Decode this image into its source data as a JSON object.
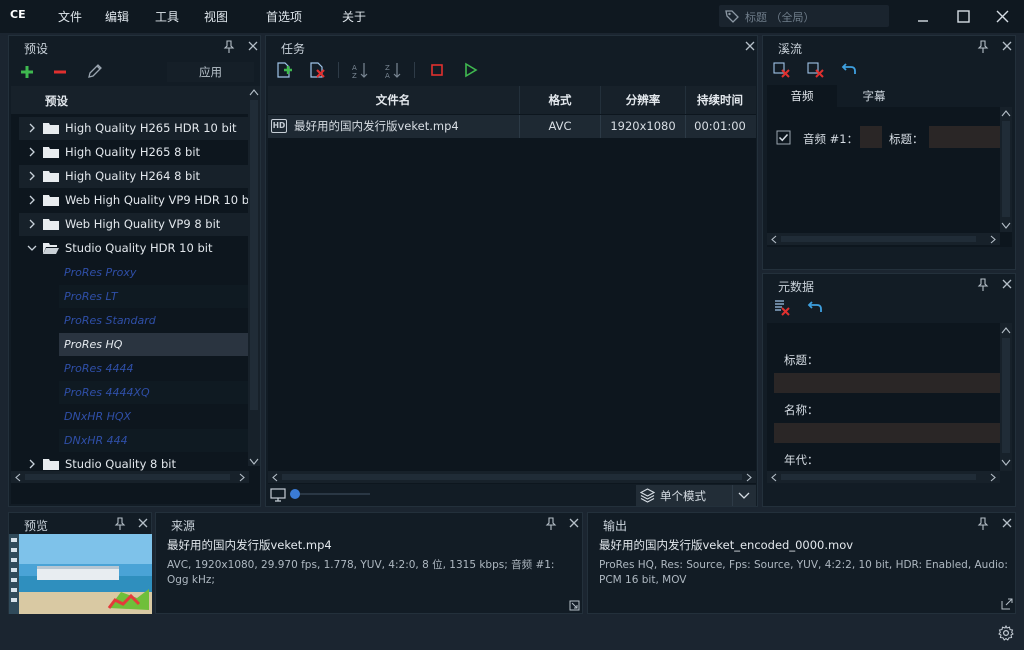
{
  "app": {
    "logo": "CE"
  },
  "menu": [
    "文件",
    "编辑",
    "工具",
    "视图",
    "首选项",
    "关于"
  ],
  "search": {
    "placeholder": "标题  （全局）"
  },
  "presets": {
    "title": "预设",
    "apply_label": "应用",
    "column_header": "预设",
    "groups": [
      {
        "label": "High Quality H265 HDR 10 bit",
        "expanded": false
      },
      {
        "label": "High Quality H265 8 bit",
        "expanded": false
      },
      {
        "label": "High Quality H264 8 bit",
        "expanded": false
      },
      {
        "label": "Web High Quality VP9 HDR 10 bit",
        "expanded": false
      },
      {
        "label": "Web High Quality VP9 8 bit",
        "expanded": false
      },
      {
        "label": "Studio Quality HDR 10 bit",
        "expanded": true
      },
      {
        "label": "Studio Quality 8 bit",
        "expanded": false
      }
    ],
    "sub_items": [
      "ProRes Proxy",
      "ProRes LT",
      "ProRes Standard",
      "ProRes HQ",
      "ProRes 4444",
      "ProRes 4444XQ",
      "DNxHR HQX",
      "DNxHR 444"
    ],
    "selected": "ProRes HQ"
  },
  "tasks": {
    "title": "任务",
    "columns": [
      "文件名",
      "格式",
      "分辨率",
      "持续时间"
    ],
    "rows": [
      {
        "filename": "最好用的国内发行版veket.mp4",
        "format": "AVC",
        "resolution": "1920x1080",
        "duration": "00:01:00",
        "badge": "HD"
      }
    ],
    "mode_label": "单个模式"
  },
  "streams": {
    "title": "溪流",
    "tabs": [
      "音频",
      "字幕"
    ],
    "audio_label": "音频 #1：",
    "audio_title_label": "标题：",
    "audio_checked": true
  },
  "metadata": {
    "title": "元数据",
    "fields": [
      "标题：",
      "名称：",
      "年代："
    ]
  },
  "preview": {
    "title": "预览"
  },
  "source": {
    "title": "来源",
    "filename": "最好用的国内发行版veket.mp4",
    "details": "AVC, 1920x1080, 29.970 fps, 1.778, YUV, 4:2:0, 8 位, 1315 kbps; 音频 #1: Ogg kHz;"
  },
  "output": {
    "title": "输出",
    "filename": "最好用的国内发行版veket_encoded_0000.mov",
    "details": "ProRes HQ, Res: Source, Fps: Source, YUV, 4:2:2, 10 bit, HDR: Enabled, Audio: PCM 16 bit, MOV"
  },
  "colors": {
    "accent_green": "#3fb950",
    "accent_red": "#e0302f",
    "selection": "#2a3440",
    "sub_item_text": "#2f4fa8"
  }
}
